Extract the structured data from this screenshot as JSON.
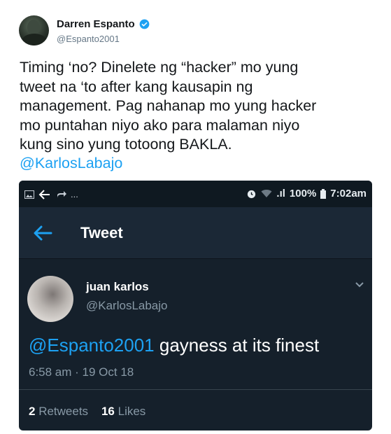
{
  "author": {
    "display_name": "Darren Espanto",
    "handle": "@Espanto2001",
    "avatar_icon": "profile-photo",
    "verified_icon": "verified-badge-icon"
  },
  "tweet": {
    "text": "Timing ‘no? Dinelete ng “hacker” mo yung\ntweet na ‘to after kang kausapin ng\nmanagement. Pag nahanap mo yung hacker\nmo puntahan niyo ako para malaman niyo\nkung sino yung totoong BAKLA.",
    "mention": "@KarlosLabajo"
  },
  "embedded_screenshot": {
    "status_bar": {
      "left_dots": "...",
      "signal": ".ıl",
      "battery_percent": "100%",
      "time": "7:02am"
    },
    "app_bar_title": "Tweet",
    "quoted_tweet": {
      "display_name": "juan karlos",
      "handle": "@KarlosLabajo",
      "mention": "@Espanto2001",
      "text": " gayness at its finest",
      "timestamp": "6:58 am · 19 Oct 18",
      "retweets_count": "2",
      "retweets_label": " Retweets",
      "likes_count": "16",
      "likes_label": " Likes"
    }
  },
  "colors": {
    "link_blue": "#1da1f2",
    "dark_bg": "#15202b",
    "muted_text": "#8899a6"
  }
}
